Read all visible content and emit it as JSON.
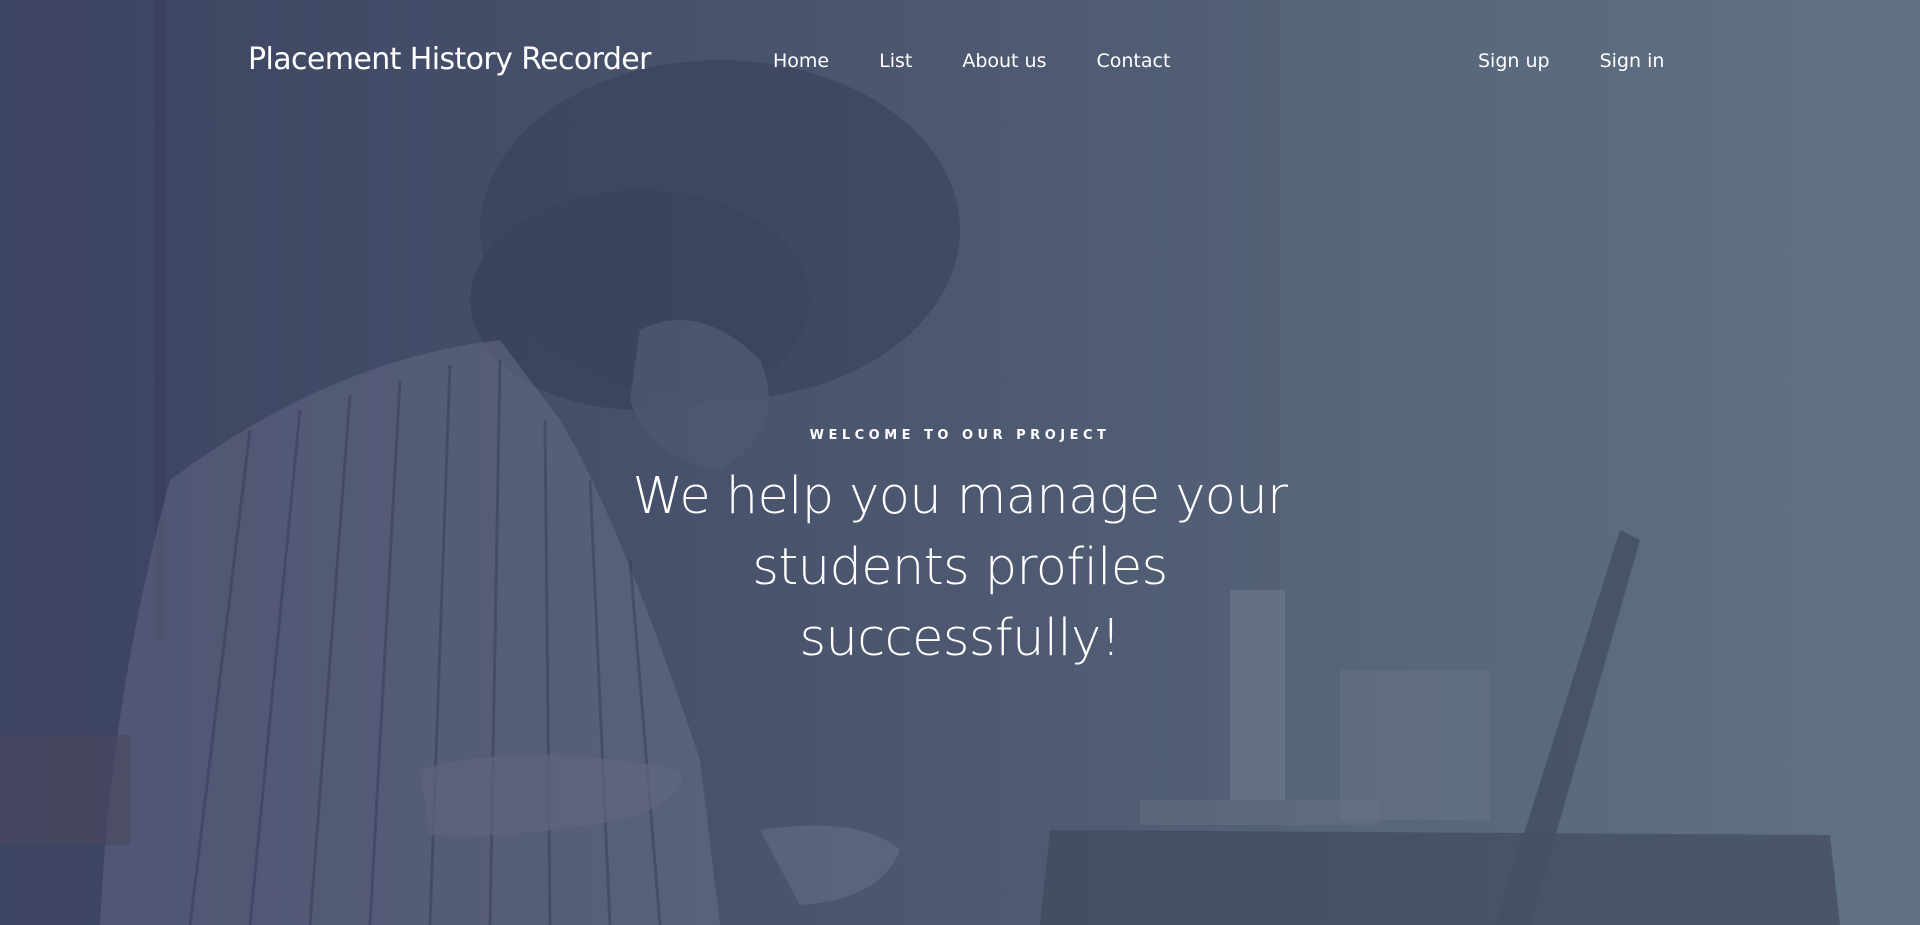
{
  "nav": {
    "brand": "Placement History Recorder",
    "links": [
      "Home",
      "List",
      "About us",
      "Contact"
    ],
    "auth": [
      "Sign up",
      "Sign in"
    ]
  },
  "hero": {
    "eyebrow": "Welcome to our project",
    "headline": "We help you manage your students profiles successfully!"
  },
  "colors": {
    "background_left": "#3f4763",
    "background_right": "#5f7283",
    "text": "#ffffff"
  },
  "background_image": "woman-with-curly-hair-at-desk-photo"
}
